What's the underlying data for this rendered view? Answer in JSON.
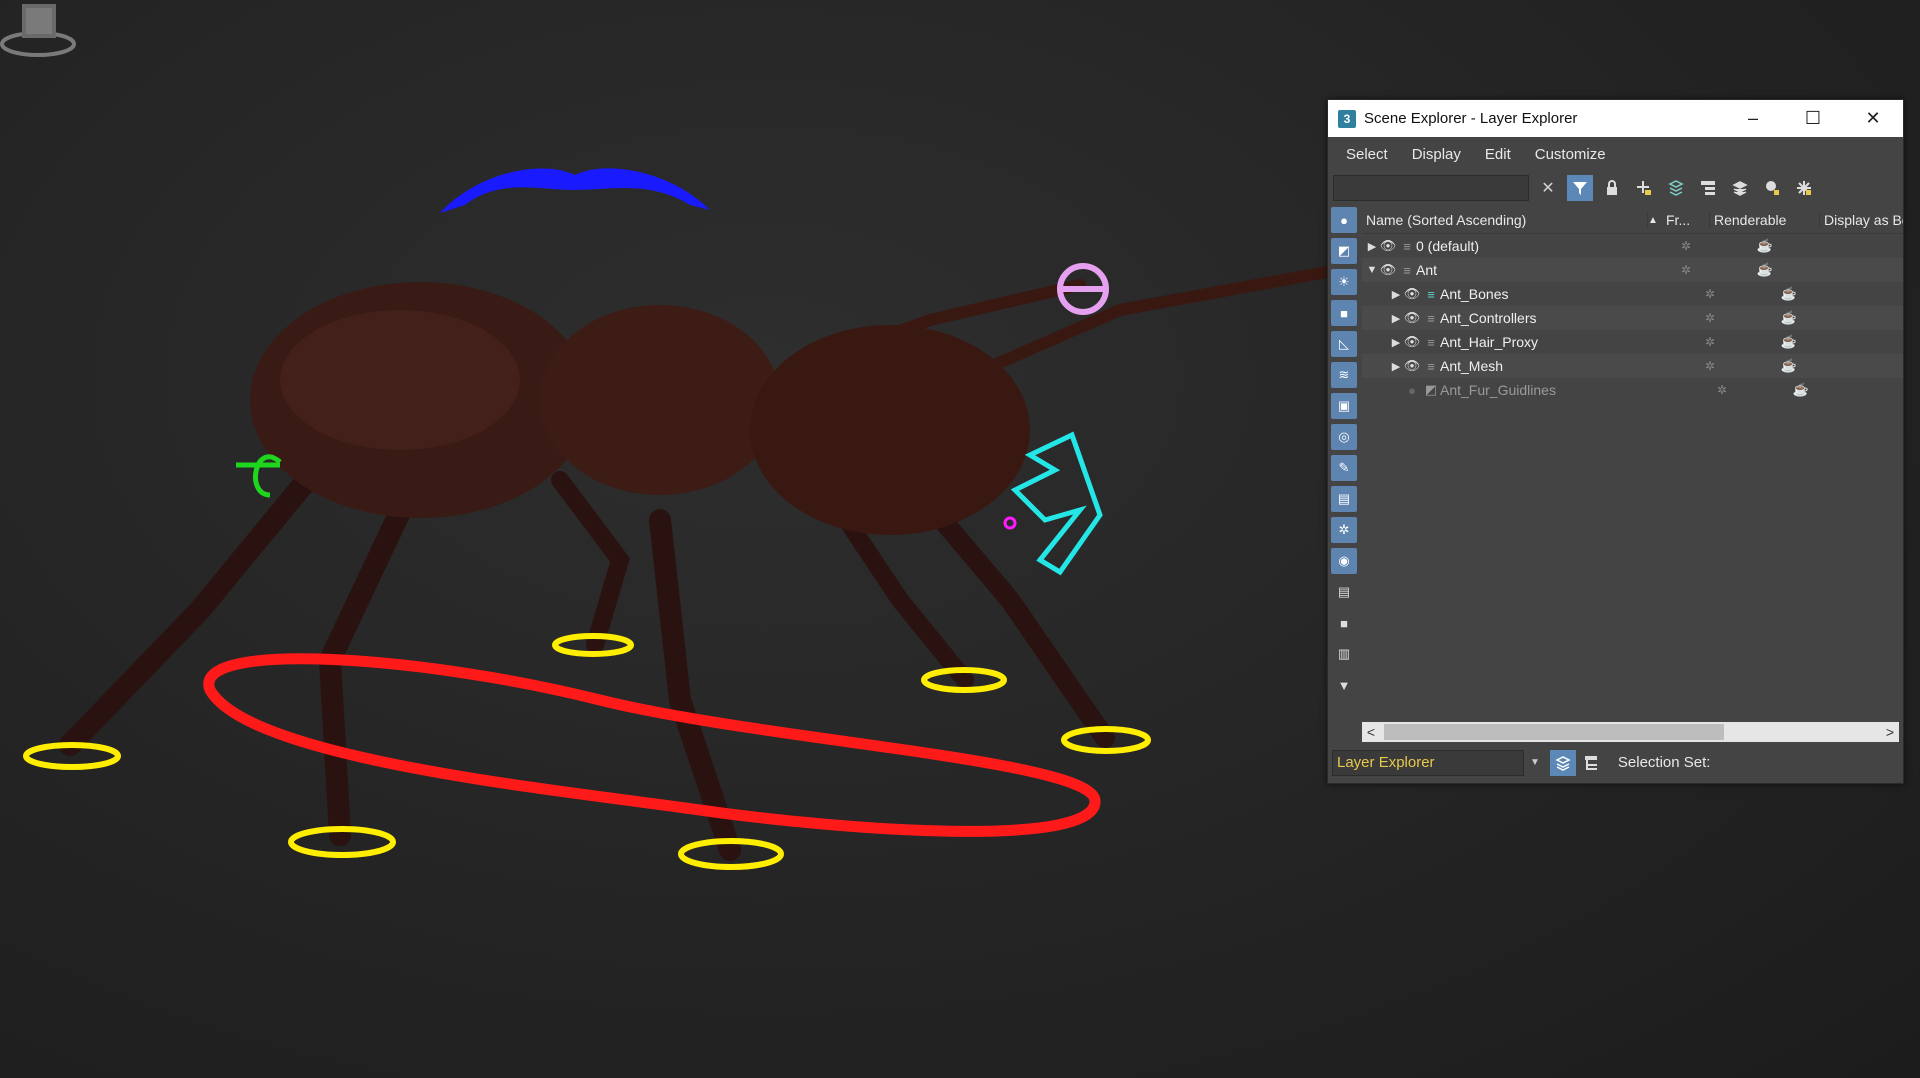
{
  "window": {
    "title": "Scene Explorer - Layer Explorer",
    "app_icon": "3",
    "minimize": "–",
    "maximize": "☐",
    "close": "✕"
  },
  "menu": [
    "Select",
    "Display",
    "Edit",
    "Customize"
  ],
  "search": {
    "value": "",
    "clear": "✕"
  },
  "columns": [
    "Name (Sorted Ascending)",
    "▲",
    "Fr...",
    "Renderable",
    "Display as Bo:"
  ],
  "tree": [
    {
      "name": "0 (default)",
      "arrow": "▶",
      "level": 0
    },
    {
      "name": "Ant",
      "arrow": "▼",
      "level": 0
    },
    {
      "name": "Ant_Bones",
      "arrow": "▶",
      "level": 1
    },
    {
      "name": "Ant_Controllers",
      "arrow": "▶",
      "level": 1
    },
    {
      "name": "Ant_Hair_Proxy",
      "arrow": "▶",
      "level": 1
    },
    {
      "name": "Ant_Mesh",
      "arrow": "▶",
      "level": 1
    },
    {
      "name": "Ant_Fur_Guidlines",
      "arrow": "",
      "level": 1
    }
  ],
  "status": {
    "mode": "Layer Explorer",
    "selection_set": "Selection Set:"
  },
  "scroll": {
    "left": "<",
    "right": ">"
  },
  "colors": {
    "accent": "#5b88b7",
    "mode_text": "#e8c94c",
    "foot_rings": "#ffee00",
    "body_ctrl": "#ff1a1a",
    "head_ctrl": "#1a1aff",
    "jaw_ctrl": "#24e6e6",
    "antenna_ctrl": "#e6a0f0",
    "tail_ctrl": "#1ed61e"
  }
}
